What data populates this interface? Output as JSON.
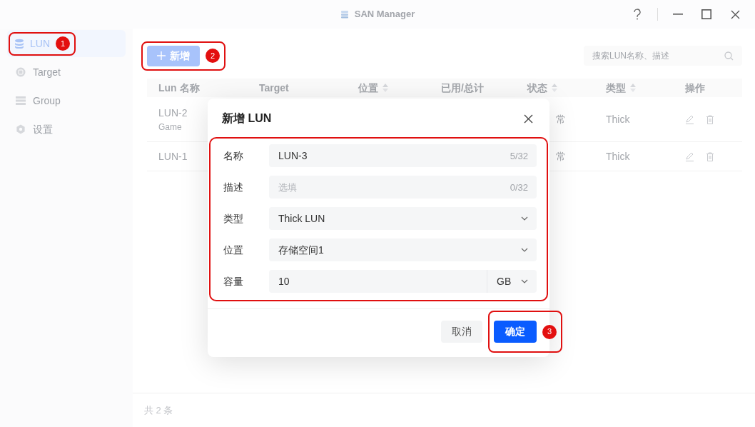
{
  "window": {
    "title": "SAN Manager"
  },
  "sidebar": {
    "items": [
      {
        "label": "LUN",
        "selected": true,
        "callout": "1"
      },
      {
        "label": "Target",
        "selected": false
      },
      {
        "label": "Group",
        "selected": false
      },
      {
        "label": "设置",
        "selected": false
      }
    ]
  },
  "toolbar": {
    "add_button": {
      "label": "新增",
      "callout": "2"
    },
    "search": {
      "placeholder": "搜索LUN名称、描述"
    }
  },
  "table": {
    "columns": [
      {
        "label": "Lun 名称",
        "sortable": false
      },
      {
        "label": "Target",
        "sortable": false
      },
      {
        "label": "位置",
        "sortable": true
      },
      {
        "label": "已用/总计",
        "sortable": false
      },
      {
        "label": "状态",
        "sortable": true
      },
      {
        "label": "类型",
        "sortable": true
      },
      {
        "label": "操作",
        "sortable": false
      }
    ],
    "rows": [
      {
        "name": "LUN-2",
        "description": "Game",
        "status": "常",
        "type": "Thick"
      },
      {
        "name": "LUN-1",
        "status": "常",
        "type": "Thick"
      }
    ]
  },
  "footer": {
    "total": "共 2 条"
  },
  "modal": {
    "title": "新增 LUN",
    "form_highlighted": true,
    "fields": [
      {
        "kind": "text",
        "label": "名称",
        "value": "LUN-3",
        "counter": "5/32"
      },
      {
        "kind": "text",
        "label": "描述",
        "placeholder": "选填",
        "counter": "0/32"
      },
      {
        "kind": "select",
        "label": "类型",
        "value": "Thick LUN"
      },
      {
        "kind": "select",
        "label": "位置",
        "value": "存储空间1"
      },
      {
        "kind": "number_unit",
        "label": "容量",
        "value": "10",
        "unit": "GB"
      }
    ],
    "cancel": "取消",
    "confirm": {
      "label": "确定",
      "callout": "3"
    }
  }
}
